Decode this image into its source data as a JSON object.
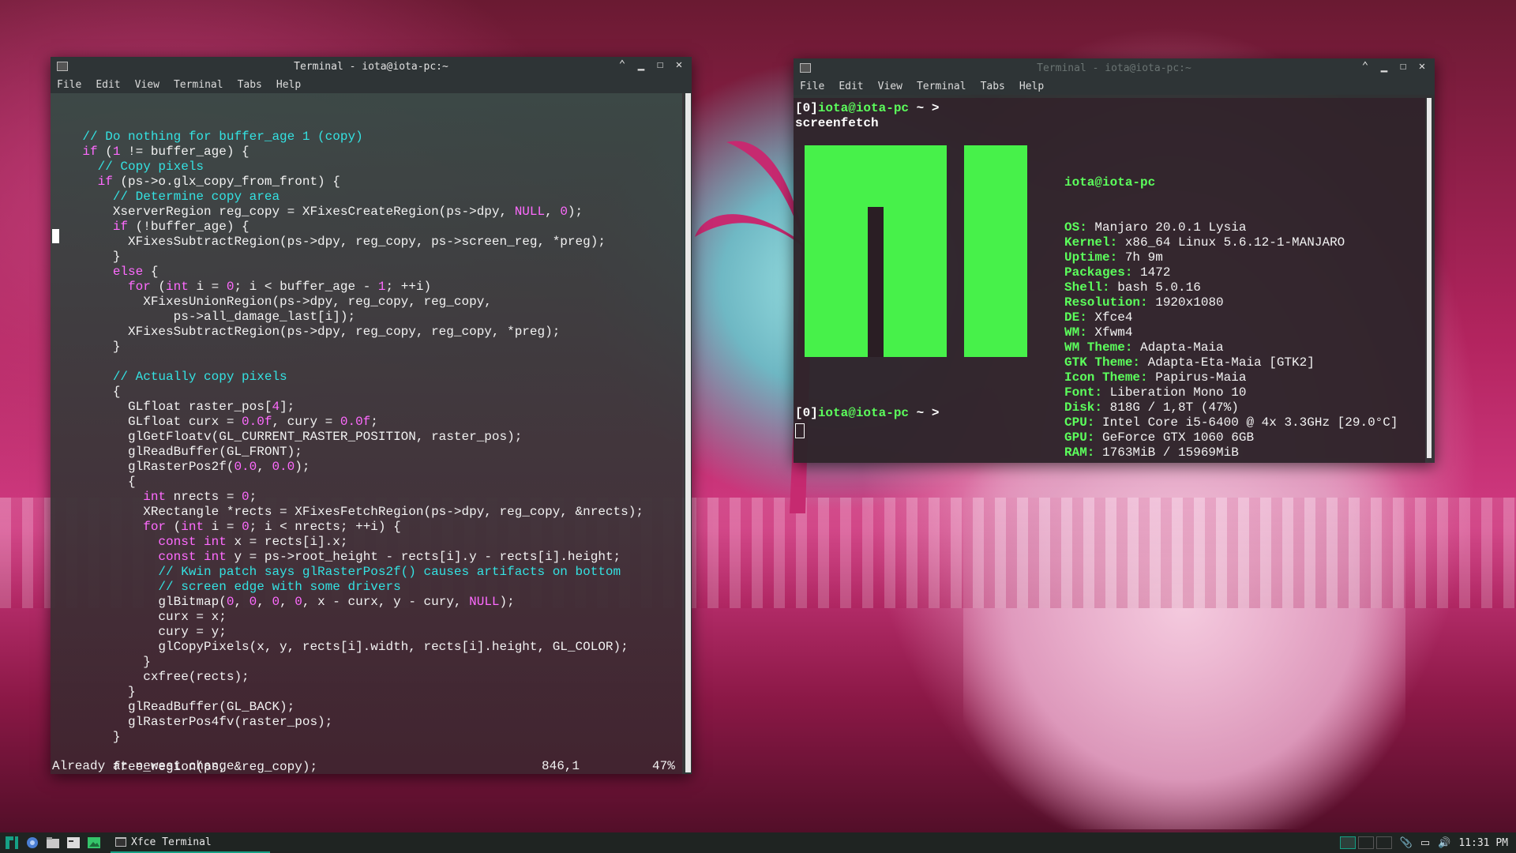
{
  "left_window": {
    "title": "Terminal - iota@iota-pc:~",
    "menu": [
      "File",
      "Edit",
      "View",
      "Terminal",
      "Tabs",
      "Help"
    ],
    "status_message": "Already at newest change",
    "status_position": "846,1",
    "status_percent": "47%"
  },
  "right_window": {
    "title": "Terminal - iota@iota-pc:~",
    "menu": [
      "File",
      "Edit",
      "View",
      "Terminal",
      "Tabs",
      "Help"
    ],
    "prompt_index": "[0]",
    "prompt_user": "iota@iota-pc",
    "prompt_path": " ~ > ",
    "command": "screenfetch",
    "info_header": "iota@iota-pc",
    "info": [
      {
        "key": "OS:",
        "value": " Manjaro 20.0.1 Lysia"
      },
      {
        "key": "Kernel:",
        "value": " x86_64 Linux 5.6.12-1-MANJARO"
      },
      {
        "key": "Uptime:",
        "value": " 7h 9m"
      },
      {
        "key": "Packages:",
        "value": " 1472"
      },
      {
        "key": "Shell:",
        "value": " bash 5.0.16"
      },
      {
        "key": "Resolution:",
        "value": " 1920x1080"
      },
      {
        "key": "DE:",
        "value": " Xfce4"
      },
      {
        "key": "WM:",
        "value": " Xfwm4"
      },
      {
        "key": "WM Theme:",
        "value": " Adapta-Maia"
      },
      {
        "key": "GTK Theme:",
        "value": " Adapta-Eta-Maia [GTK2]"
      },
      {
        "key": "Icon Theme:",
        "value": " Papirus-Maia"
      },
      {
        "key": "Font:",
        "value": " Liberation Mono 10"
      },
      {
        "key": "Disk:",
        "value": " 818G / 1,8T (47%)"
      },
      {
        "key": "CPU:",
        "value": " Intel Core i5-6400 @ 4x 3.3GHz [29.0°C]"
      },
      {
        "key": "GPU:",
        "value": " GeForce GTX 1060 6GB"
      },
      {
        "key": "RAM:",
        "value": " 1763MiB / 15969MiB"
      }
    ],
    "logo_color": "#47f14a"
  },
  "code_lines": [
    [
      {
        "t": "    "
      },
      {
        "t": "// Do nothing for buffer_age 1 (copy)",
        "c": "c-com"
      }
    ],
    [
      {
        "t": "    "
      },
      {
        "t": "if",
        "c": "c-kw"
      },
      {
        "t": " ("
      },
      {
        "t": "1",
        "c": "c-num"
      },
      {
        "t": " != buffer_age) {"
      }
    ],
    [
      {
        "t": "      "
      },
      {
        "t": "// Copy pixels",
        "c": "c-com"
      }
    ],
    [
      {
        "t": "      "
      },
      {
        "t": "if",
        "c": "c-kw"
      },
      {
        "t": " (ps->o.glx_copy_from_front) {"
      }
    ],
    [
      {
        "t": "        "
      },
      {
        "t": "// Determine copy area",
        "c": "c-com"
      }
    ],
    [
      {
        "t": "        XserverRegion reg_copy = XFixesCreateRegion(ps->dpy, "
      },
      {
        "t": "NULL",
        "c": "c-num"
      },
      {
        "t": ", "
      },
      {
        "t": "0",
        "c": "c-num"
      },
      {
        "t": ");"
      }
    ],
    [
      {
        "t": "        "
      },
      {
        "t": "if",
        "c": "c-kw"
      },
      {
        "t": " (!buffer_age) {"
      }
    ],
    [
      {
        "t": "          XFixesSubtractRegion(ps->dpy, reg_copy, ps->screen_reg, *preg);"
      }
    ],
    [
      {
        "t": "        }"
      }
    ],
    [
      {
        "t": "        "
      },
      {
        "t": "else",
        "c": "c-kw"
      },
      {
        "t": " {"
      }
    ],
    [
      {
        "t": "          "
      },
      {
        "t": "for",
        "c": "c-kw"
      },
      {
        "t": " ("
      },
      {
        "t": "int",
        "c": "c-ty"
      },
      {
        "t": " i = "
      },
      {
        "t": "0",
        "c": "c-num"
      },
      {
        "t": "; i < buffer_age - "
      },
      {
        "t": "1",
        "c": "c-num"
      },
      {
        "t": "; ++i)"
      }
    ],
    [
      {
        "t": "            XFixesUnionRegion(ps->dpy, reg_copy, reg_copy,"
      }
    ],
    [
      {
        "t": "                ps->all_damage_last[i]);"
      }
    ],
    [
      {
        "t": "          XFixesSubtractRegion(ps->dpy, reg_copy, reg_copy, *preg);"
      }
    ],
    [
      {
        "t": "        }"
      }
    ],
    [
      {
        "t": ""
      }
    ],
    [
      {
        "t": "        "
      },
      {
        "t": "// Actually copy pixels",
        "c": "c-com"
      }
    ],
    [
      {
        "t": "        {"
      }
    ],
    [
      {
        "t": "          GLfloat raster_pos["
      },
      {
        "t": "4",
        "c": "c-num"
      },
      {
        "t": "];"
      }
    ],
    [
      {
        "t": "          GLfloat curx = "
      },
      {
        "t": "0.0f",
        "c": "c-num"
      },
      {
        "t": ", cury = "
      },
      {
        "t": "0.0f",
        "c": "c-num"
      },
      {
        "t": ";"
      }
    ],
    [
      {
        "t": "          glGetFloatv(GL_CURRENT_RASTER_POSITION, raster_pos);"
      }
    ],
    [
      {
        "t": "          glReadBuffer(GL_FRONT);"
      }
    ],
    [
      {
        "t": "          glRasterPos2f("
      },
      {
        "t": "0.0",
        "c": "c-num"
      },
      {
        "t": ", "
      },
      {
        "t": "0.0",
        "c": "c-num"
      },
      {
        "t": ");"
      }
    ],
    [
      {
        "t": "          {"
      }
    ],
    [
      {
        "t": "            "
      },
      {
        "t": "int",
        "c": "c-ty"
      },
      {
        "t": " nrects = "
      },
      {
        "t": "0",
        "c": "c-num"
      },
      {
        "t": ";"
      }
    ],
    [
      {
        "t": "            XRectangle *rects = XFixesFetchRegion(ps->dpy, reg_copy, &nrects);"
      }
    ],
    [
      {
        "t": "            "
      },
      {
        "t": "for",
        "c": "c-kw"
      },
      {
        "t": " ("
      },
      {
        "t": "int",
        "c": "c-ty"
      },
      {
        "t": " i = "
      },
      {
        "t": "0",
        "c": "c-num"
      },
      {
        "t": "; i < nrects; ++i) {"
      }
    ],
    [
      {
        "t": "              "
      },
      {
        "t": "const",
        "c": "c-kw"
      },
      {
        "t": " "
      },
      {
        "t": "int",
        "c": "c-ty"
      },
      {
        "t": " x = rects[i].x;"
      }
    ],
    [
      {
        "t": "              "
      },
      {
        "t": "const",
        "c": "c-kw"
      },
      {
        "t": " "
      },
      {
        "t": "int",
        "c": "c-ty"
      },
      {
        "t": " y = ps->root_height - rects[i].y - rects[i].height;"
      }
    ],
    [
      {
        "t": "              "
      },
      {
        "t": "// Kwin patch says glRasterPos2f() causes artifacts on bottom",
        "c": "c-com"
      }
    ],
    [
      {
        "t": "              "
      },
      {
        "t": "// screen edge with some drivers",
        "c": "c-com"
      }
    ],
    [
      {
        "t": "              glBitmap("
      },
      {
        "t": "0",
        "c": "c-num"
      },
      {
        "t": ", "
      },
      {
        "t": "0",
        "c": "c-num"
      },
      {
        "t": ", "
      },
      {
        "t": "0",
        "c": "c-num"
      },
      {
        "t": ", "
      },
      {
        "t": "0",
        "c": "c-num"
      },
      {
        "t": ", x - curx, y - cury, "
      },
      {
        "t": "NULL",
        "c": "c-num"
      },
      {
        "t": ");"
      }
    ],
    [
      {
        "t": "              curx = x;"
      }
    ],
    [
      {
        "t": "              cury = y;"
      }
    ],
    [
      {
        "t": "              glCopyPixels(x, y, rects[i].width, rects[i].height, GL_COLOR);"
      }
    ],
    [
      {
        "t": "            }"
      }
    ],
    [
      {
        "t": "            cxfree(rects);"
      }
    ],
    [
      {
        "t": "          }"
      }
    ],
    [
      {
        "t": "          glReadBuffer(GL_BACK);"
      }
    ],
    [
      {
        "t": "          glRasterPos4fv(raster_pos);"
      }
    ],
    [
      {
        "t": "        }"
      }
    ],
    [
      {
        "t": ""
      }
    ],
    [
      {
        "t": "        free_region(ps, &reg_copy);"
      }
    ]
  ],
  "taskbar": {
    "task_label": "Xfce Terminal",
    "clock": "11:31 PM",
    "accent": "#16a085"
  }
}
